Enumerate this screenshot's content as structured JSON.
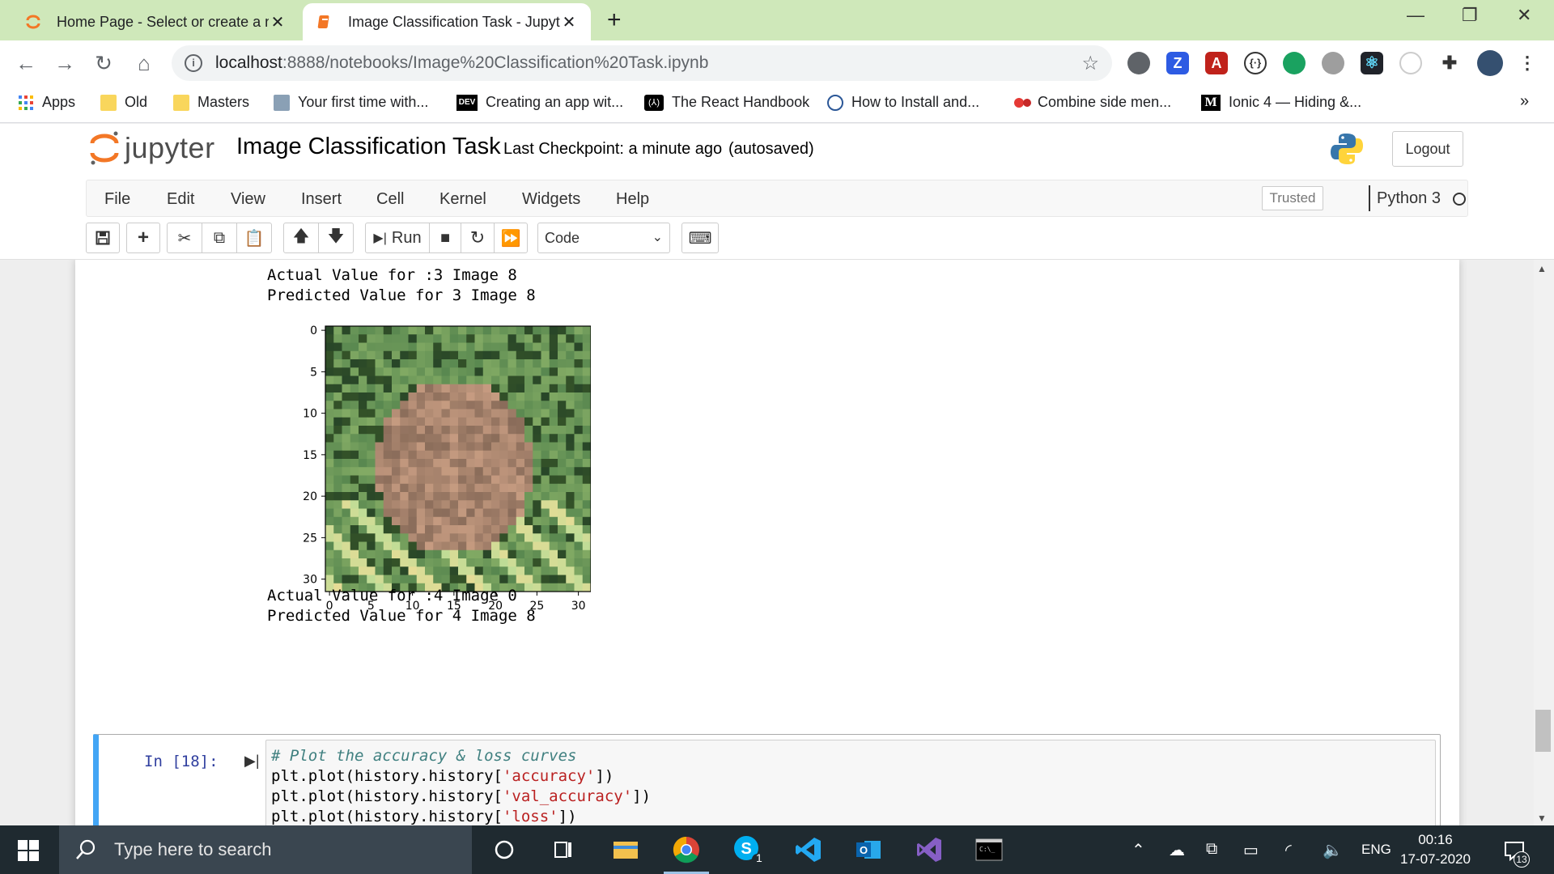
{
  "browser": {
    "tabs": [
      {
        "title": "Home Page - Select or create a n",
        "active": false
      },
      {
        "title": "Image Classification Task - Jupyte",
        "active": true
      }
    ],
    "url_host": "localhost",
    "url_path": ":8888/notebooks/Image%20Classification%20Task.ipynb",
    "bookmarks": [
      {
        "label": "Apps",
        "icon": "apps-grid-icon"
      },
      {
        "label": "Old",
        "icon": "folder-icon"
      },
      {
        "label": "Masters",
        "icon": "folder-icon"
      },
      {
        "label": "Your first time with...",
        "icon": "page-icon"
      },
      {
        "label": "Creating an app wit...",
        "icon": "dev-icon"
      },
      {
        "label": "The React Handbook",
        "icon": "react-handbook-icon"
      },
      {
        "label": "How to Install and...",
        "icon": "globe-icon"
      },
      {
        "label": "Combine side men...",
        "icon": "menu-icon"
      },
      {
        "label": "Ionic 4 — Hiding &...",
        "icon": "medium-icon"
      }
    ],
    "bookmarks_overflow": "»"
  },
  "jupyter": {
    "logo_text": "jupyter",
    "notebook_title": "Image Classification Task",
    "checkpoint": "Last Checkpoint: a minute ago",
    "autosave": "(autosaved)",
    "logout": "Logout",
    "menu": [
      "File",
      "Edit",
      "View",
      "Insert",
      "Cell",
      "Kernel",
      "Widgets",
      "Help"
    ],
    "trusted": "Trusted",
    "kernel": "Python 3",
    "run_label": "Run",
    "cell_type": "Code"
  },
  "output": {
    "block1": [
      "Actual Value for :3 Image 8",
      "Predicted Value for 3 Image 8"
    ],
    "plot": {
      "x_ticks": [
        "0",
        "5",
        "10",
        "15",
        "20",
        "25",
        "30"
      ],
      "y_ticks": [
        "0",
        "5",
        "10",
        "15",
        "20",
        "25",
        "30"
      ]
    },
    "block2": [
      "Actual Value for :4 Image 0",
      "Predicted Value for 4 Image 8"
    ]
  },
  "cell": {
    "prompt": "In [18]:",
    "lines": [
      {
        "parts": [
          {
            "t": "# Plot the accuracy & loss curves",
            "c": "comment"
          }
        ]
      },
      {
        "parts": [
          {
            "t": "plt.plot(history.history[",
            "c": ""
          },
          {
            "t": "'accuracy'",
            "c": "string"
          },
          {
            "t": "])",
            "c": ""
          }
        ]
      },
      {
        "parts": [
          {
            "t": "plt.plot(history.history[",
            "c": ""
          },
          {
            "t": "'val_accuracy'",
            "c": "string"
          },
          {
            "t": "])",
            "c": ""
          }
        ]
      },
      {
        "parts": [
          {
            "t": "plt.plot(history.history[",
            "c": ""
          },
          {
            "t": "'loss'",
            "c": "string"
          },
          {
            "t": "])",
            "c": ""
          }
        ]
      }
    ]
  },
  "taskbar": {
    "search_placeholder": "Type here to search",
    "language": "ENG",
    "time": "00:16",
    "date": "17-07-2020",
    "notifications": "13",
    "skype_badge": "1"
  },
  "colors": {
    "tabstrip": "#cfe8ba",
    "jupyter_orange": "#f37726",
    "cell_selected": "#42a5f5",
    "taskbar": "#1f2a30"
  }
}
